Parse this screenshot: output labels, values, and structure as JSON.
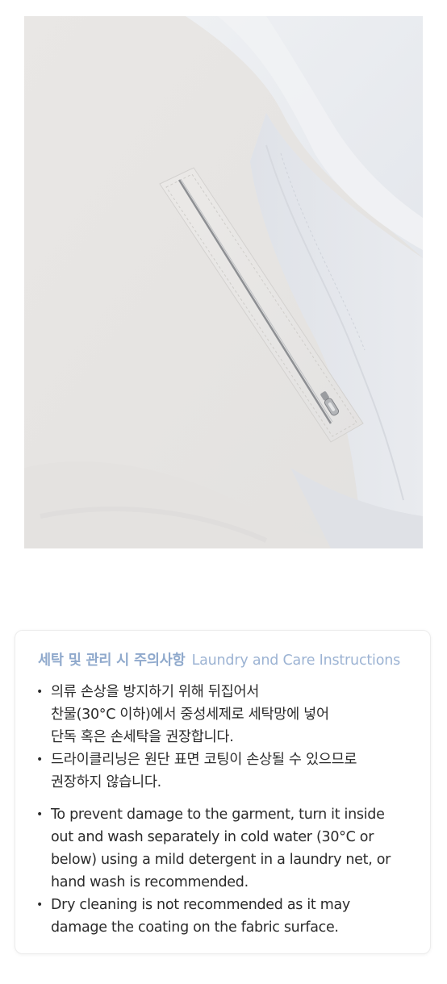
{
  "care": {
    "title_ko": "세탁 및 관리 시 주의사항",
    "title_en": "Laundry and Care Instructions",
    "items_ko": [
      {
        "lines": [
          "의류 손상을 방지하기 위해 뒤집어서",
          "찬물(30°C 이하)에서 중성세제로 세탁망에 넣어",
          "단독 혹은 손세탁을 권장합니다."
        ]
      },
      {
        "lines": [
          "드라이클리닝은 원단 표면 코팅이 손상될 수 있으므로",
          "권장하지 않습니다."
        ]
      }
    ],
    "items_en": [
      {
        "lines": [
          "To prevent damage to the garment, turn it inside",
          "out and wash separately in cold water (30°C or",
          "below) using a mild detergent in a laundry net, or",
          "hand wash is recommended."
        ]
      },
      {
        "lines": [
          "Dry cleaning is not recommended as it may",
          "damage the coating on the fabric surface."
        ]
      }
    ],
    "bullet": "•"
  }
}
